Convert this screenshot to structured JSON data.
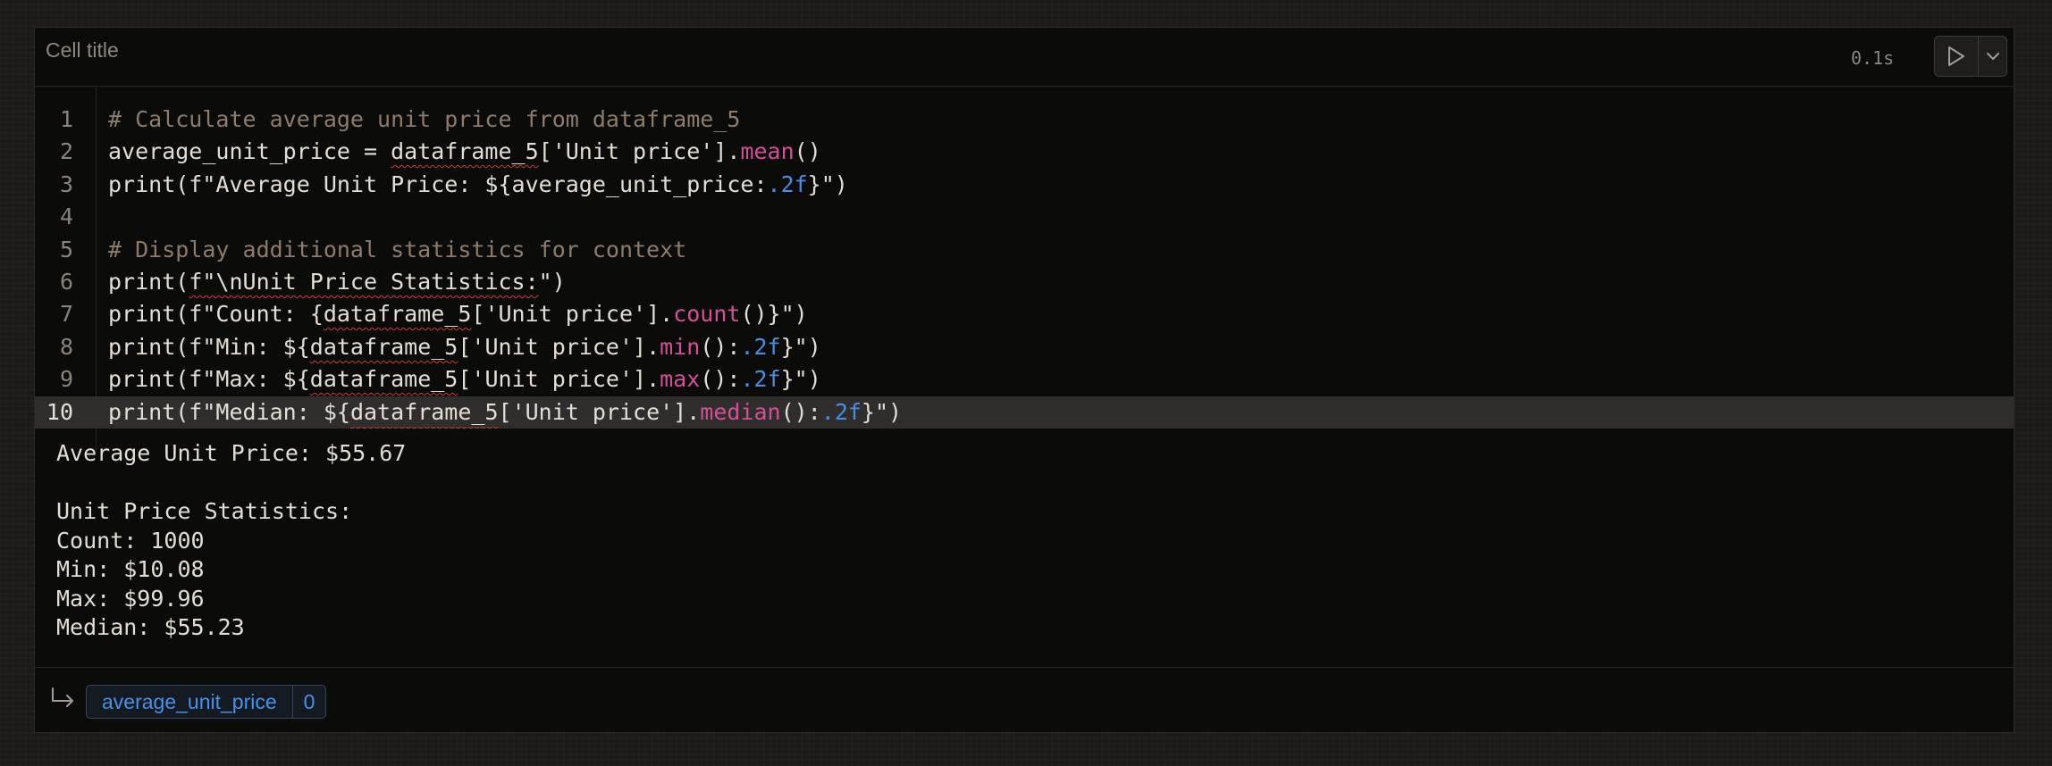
{
  "cell": {
    "title": "Cell title",
    "exec_time": "0.1s",
    "run_icon": "play-icon",
    "dropdown_icon": "chevron-down-icon"
  },
  "code_lines": [
    {
      "num": "1",
      "segments": [
        {
          "cls": "cm",
          "t": "# Calculate average unit price from dataframe_5"
        }
      ]
    },
    {
      "num": "2",
      "segments": [
        {
          "cls": "",
          "t": "average_unit_price = "
        },
        {
          "cls": "sq",
          "t": "dataframe_5"
        },
        {
          "cls": "",
          "t": "['Unit price']."
        },
        {
          "cls": "fn",
          "t": "mean"
        },
        {
          "cls": "",
          "t": "()"
        }
      ]
    },
    {
      "num": "3",
      "segments": [
        {
          "cls": "",
          "t": "print(f\"Average Unit Price: ${average_unit_price:"
        },
        {
          "cls": "num",
          "t": ".2f"
        },
        {
          "cls": "",
          "t": "}\")"
        }
      ]
    },
    {
      "num": "4",
      "segments": []
    },
    {
      "num": "5",
      "segments": [
        {
          "cls": "cm",
          "t": "# Display additional statistics for context"
        }
      ]
    },
    {
      "num": "6",
      "segments": [
        {
          "cls": "",
          "t": "print("
        },
        {
          "cls": "sq",
          "t": "f\"\\nUnit Price Statistics:"
        },
        {
          "cls": "",
          "t": "\")"
        }
      ]
    },
    {
      "num": "7",
      "segments": [
        {
          "cls": "",
          "t": "print(f\"Count: {"
        },
        {
          "cls": "sq",
          "t": "dataframe_5"
        },
        {
          "cls": "",
          "t": "['Unit price']."
        },
        {
          "cls": "fn",
          "t": "count"
        },
        {
          "cls": "",
          "t": "()}\")"
        }
      ]
    },
    {
      "num": "8",
      "segments": [
        {
          "cls": "",
          "t": "print(f\"Min: ${"
        },
        {
          "cls": "sq",
          "t": "dataframe_5"
        },
        {
          "cls": "",
          "t": "['Unit price']."
        },
        {
          "cls": "fn",
          "t": "min"
        },
        {
          "cls": "",
          "t": "():"
        },
        {
          "cls": "num",
          "t": ".2f"
        },
        {
          "cls": "",
          "t": "}\")"
        }
      ]
    },
    {
      "num": "9",
      "segments": [
        {
          "cls": "",
          "t": "print(f\"Max: ${"
        },
        {
          "cls": "sq",
          "t": "dataframe_5"
        },
        {
          "cls": "",
          "t": "['Unit price']."
        },
        {
          "cls": "fn",
          "t": "max"
        },
        {
          "cls": "",
          "t": "():"
        },
        {
          "cls": "num",
          "t": ".2f"
        },
        {
          "cls": "",
          "t": "}\")"
        }
      ]
    },
    {
      "num": "10",
      "segments": [
        {
          "cls": "",
          "t": "print(f\"Median: ${"
        },
        {
          "cls": "sq",
          "t": "dataframe_5"
        },
        {
          "cls": "",
          "t": "['Unit price']."
        },
        {
          "cls": "fn",
          "t": "median"
        },
        {
          "cls": "",
          "t": "():"
        },
        {
          "cls": "num",
          "t": ".2f"
        },
        {
          "cls": "",
          "t": "}\")"
        }
      ]
    }
  ],
  "active_line": "10",
  "output_lines": [
    "Average Unit Price: $55.67",
    "",
    "Unit Price Statistics:",
    "Count: 1000",
    "Min: $10.08",
    "Max: $99.96",
    "Median: $55.23"
  ],
  "footer": {
    "return_icon": "return-arrow-icon",
    "variable_name": "average_unit_price",
    "variable_count": "0"
  },
  "colors": {
    "comment": "#8e7b69",
    "function": "#d44f9a",
    "number": "#4a8de6",
    "chip_accent": "#4b90e8",
    "squiggle": "#d23a35"
  }
}
